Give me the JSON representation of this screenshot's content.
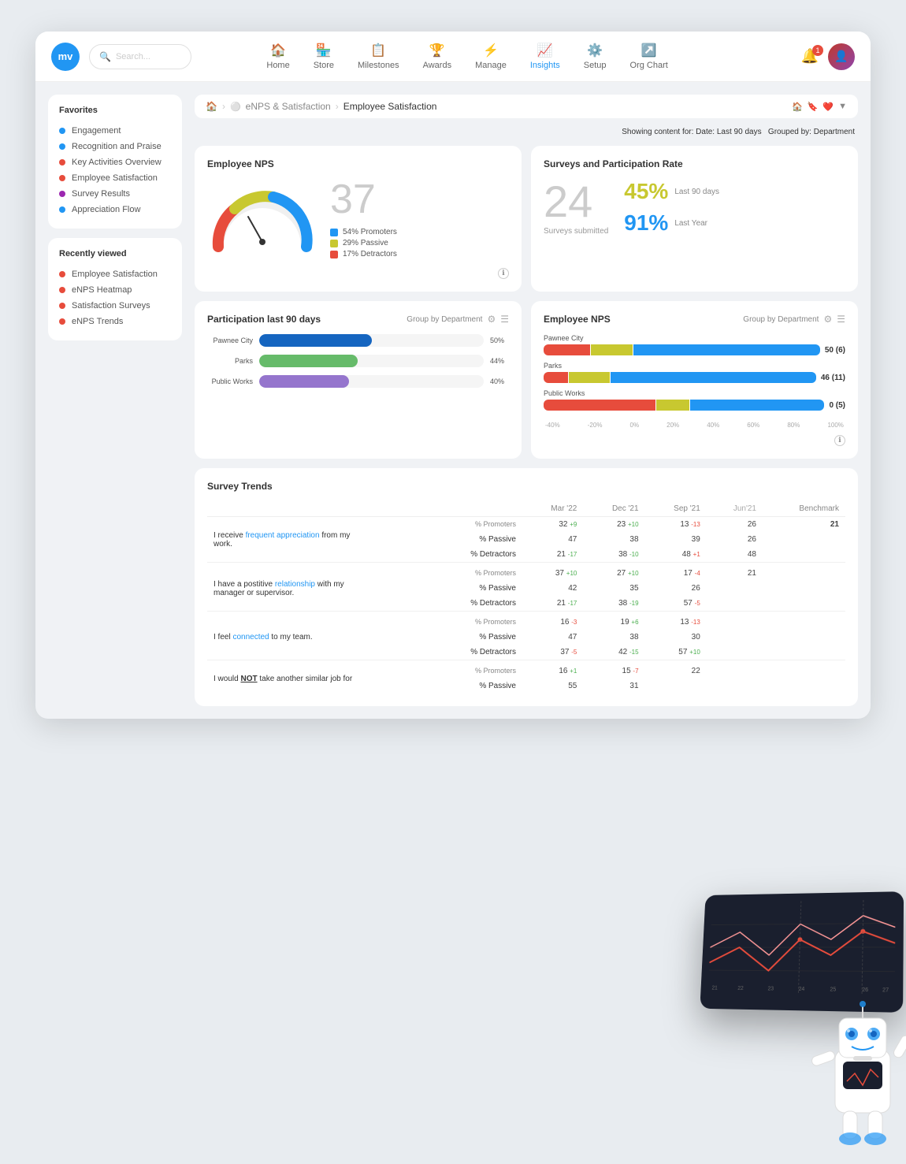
{
  "app": {
    "logo": "mv",
    "search_placeholder": "Search..."
  },
  "nav": {
    "items": [
      {
        "id": "home",
        "icon": "🏠",
        "label": "Home"
      },
      {
        "id": "store",
        "icon": "🏪",
        "label": "Store"
      },
      {
        "id": "milestones",
        "icon": "📋",
        "label": "Milestones"
      },
      {
        "id": "awards",
        "icon": "🏆",
        "label": "Awards"
      },
      {
        "id": "manage",
        "icon": "⚙️",
        "label": "Manage"
      },
      {
        "id": "insights",
        "icon": "📈",
        "label": "Insights",
        "active": true
      },
      {
        "id": "setup",
        "icon": "⚙️",
        "label": "Setup"
      },
      {
        "id": "orgchart",
        "icon": "↗️",
        "label": "Org Chart"
      }
    ],
    "notification_count": "1"
  },
  "breadcrumb": {
    "home_icon": "🏠",
    "section": "eNPS & Satisfaction",
    "page": "Employee Satisfaction",
    "icons": [
      "🏠",
      "❤️",
      "▼"
    ]
  },
  "filter_bar": {
    "showing": "Showing content for:",
    "date_label": "Date:",
    "date_value": "Last 90 days",
    "group_label": "Grouped by:",
    "group_value": "Department"
  },
  "sidebar": {
    "favorites_title": "Favorites",
    "favorites": [
      {
        "label": "Engagement",
        "color": "#2196F3"
      },
      {
        "label": "Recognition and Praise",
        "color": "#2196F3"
      },
      {
        "label": "Key Activities Overview",
        "color": "#e74c3c"
      },
      {
        "label": "Employee Satisfaction",
        "color": "#e74c3c"
      },
      {
        "label": "Survey Results",
        "color": "#9C27B0"
      },
      {
        "label": "Appreciation Flow",
        "color": "#2196F3"
      }
    ],
    "recent_title": "Recently viewed",
    "recent": [
      {
        "label": "Employee Satisfaction",
        "color": "#e74c3c"
      },
      {
        "label": "eNPS Heatmap",
        "color": "#e74c3c"
      },
      {
        "label": "Satisfaction Surveys",
        "color": "#e74c3c"
      },
      {
        "label": "eNPS Trends",
        "color": "#e74c3c"
      }
    ]
  },
  "employee_nps": {
    "title": "Employee NPS",
    "score": "37",
    "gauge": {
      "promoters_pct": 54,
      "passive_pct": 29,
      "detractors_pct": 17
    },
    "legend": [
      {
        "label": "54% Promoters",
        "color": "#2196F3"
      },
      {
        "label": "29% Passive",
        "color": "#c8c830"
      },
      {
        "label": "17% Detractors",
        "color": "#e74c3c"
      }
    ]
  },
  "surveys": {
    "title": "Surveys and Participation Rate",
    "count": "24",
    "count_label": "Surveys submitted",
    "rate_90": "45%",
    "rate_90_label": "Last 90 days",
    "rate_year": "91%",
    "rate_year_label": "Last Year",
    "rate_90_color": "#c8c830",
    "rate_year_color": "#2196F3"
  },
  "participation": {
    "title": "Participation last 90 days",
    "group_by": "Group by Department",
    "bars": [
      {
        "label": "Pawnee City",
        "pct": 50,
        "color": "#1565C0"
      },
      {
        "label": "Parks",
        "pct": 44,
        "color": "#66BB6A"
      },
      {
        "label": "Public Works",
        "pct": 40,
        "color": "#9575CD"
      }
    ]
  },
  "enps_dept": {
    "title": "Employee NPS",
    "group_by": "Group by Department",
    "rows": [
      {
        "label": "Pawnee City",
        "detractors_pct": 17,
        "passive_pct": 15,
        "promoters_pct": 68,
        "score": "50",
        "count": "(6)",
        "det_color": "#e74c3c",
        "pass_color": "#c8c830",
        "pro_color": "#2196F3"
      },
      {
        "label": "Parks",
        "detractors_pct": 9,
        "passive_pct": 15,
        "promoters_pct": 76,
        "score": "46",
        "count": "(11)",
        "det_color": "#e74c3c",
        "pass_color": "#c8c830",
        "pro_color": "#2196F3"
      },
      {
        "label": "Public Works",
        "detractors_pct": 40,
        "passive_pct": 12,
        "promoters_pct": 48,
        "score": "0",
        "count": "(5)",
        "det_color": "#e74c3c",
        "pass_color": "#c8c830",
        "pro_color": "#2196F3"
      }
    ],
    "axis": [
      "-40%",
      "-20%",
      "0%",
      "20%",
      "40%",
      "60%",
      "80%",
      "100%"
    ]
  },
  "survey_trends": {
    "title": "Survey Trends",
    "columns": [
      "",
      "",
      "Mar '22",
      "Dec '21",
      "Sep '21",
      "Jun '21",
      "Benchmark"
    ],
    "rows": [
      {
        "question": "I receive frequent appreciation from my work.",
        "highlight_word": "frequent appreciation",
        "highlight_color": "#2196F3",
        "metrics": [
          {
            "label": "% Promoters",
            "mar22": "32",
            "mar22_delta": "+9",
            "mar22_pos": true,
            "dec21": "23",
            "dec21_delta": "+10",
            "dec21_pos": true,
            "sep21": "13",
            "sep21_delta": "-13",
            "sep21_pos": false,
            "jun21": "26",
            "benchmark": "21"
          },
          {
            "label": "% Passive",
            "mar22": "47",
            "dec21": "38",
            "sep21": "39",
            "jun21": "26",
            "benchmark": ""
          },
          {
            "label": "% Detractors",
            "mar22": "21",
            "mar22_delta": "-17",
            "mar22_pos": true,
            "dec21": "38",
            "dec21_delta": "-10",
            "dec21_pos": true,
            "sep21": "48",
            "sep21_delta": "+1",
            "sep21_pos": false,
            "jun21": "48",
            "benchmark": ""
          }
        ]
      },
      {
        "question": "I have a postitive relationship with my manager or supervisor.",
        "highlight_word": "relationship",
        "highlight_color": "#2196F3",
        "metrics": [
          {
            "label": "% Promoters",
            "mar22": "37",
            "mar22_delta": "+10",
            "mar22_pos": true,
            "dec21": "27",
            "dec21_delta": "+10",
            "dec21_pos": true,
            "sep21": "17",
            "sep21_delta": "-4",
            "sep21_pos": false,
            "jun21": "21",
            "benchmark": ""
          },
          {
            "label": "% Passive",
            "mar22": "42",
            "dec21": "35",
            "sep21": "26",
            "jun21": "",
            "benchmark": ""
          },
          {
            "label": "% Detractors",
            "mar22": "21",
            "mar22_delta": "-17",
            "mar22_pos": true,
            "dec21": "38",
            "dec21_delta": "-19",
            "dec21_pos": true,
            "sep21": "57",
            "sep21_delta": "-5",
            "sep21_pos": false,
            "jun21": "",
            "benchmark": ""
          }
        ]
      },
      {
        "question": "I feel connected to my team.",
        "highlight_word": "connected",
        "highlight_color": "#2196F3",
        "metrics": [
          {
            "label": "% Promoters",
            "mar22": "16",
            "mar22_delta": "-3",
            "mar22_pos": false,
            "dec21": "19",
            "dec21_delta": "+6",
            "dec21_pos": true,
            "sep21": "13",
            "sep21_delta": "-13",
            "sep21_pos": false,
            "jun21": "",
            "benchmark": ""
          },
          {
            "label": "% Passive",
            "mar22": "47",
            "dec21": "38",
            "sep21": "30",
            "jun21": "",
            "benchmark": ""
          },
          {
            "label": "% Detractors",
            "mar22": "37",
            "mar22_delta": "-5",
            "mar22_pos": false,
            "dec21": "42",
            "dec21_delta": "-15",
            "dec21_pos": true,
            "sep21": "57",
            "sep21_delta": "+10",
            "sep21_pos": false,
            "jun21": "",
            "benchmark": ""
          }
        ]
      },
      {
        "question": "I would NOT take another similar job for",
        "highlight_word": "NOT",
        "highlight_color": "#333",
        "underline": true,
        "metrics": [
          {
            "label": "% Promoters",
            "mar22": "16",
            "mar22_delta": "+1",
            "mar22_pos": true,
            "dec21": "15",
            "dec21_delta": "-7",
            "dec21_pos": false,
            "sep21": "22",
            "jun21": "",
            "benchmark": ""
          },
          {
            "label": "% Passive",
            "mar22": "55",
            "dec21": "31",
            "sep21": "",
            "jun21": "",
            "benchmark": ""
          }
        ]
      }
    ]
  }
}
